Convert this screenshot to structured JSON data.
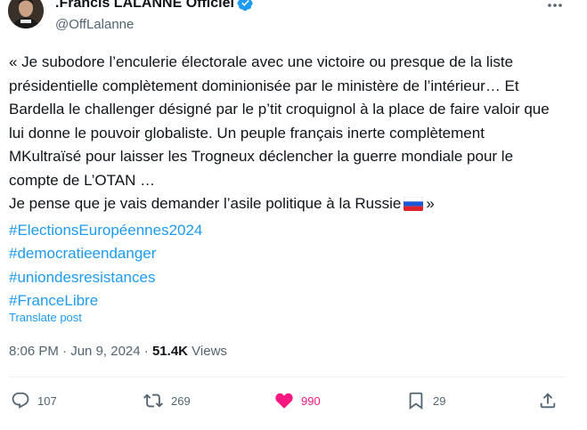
{
  "author": {
    "display_name": ".Francis LALANNE Officiel",
    "handle": "@OffLalanne",
    "verified": true,
    "verified_color": "#1d9bf0"
  },
  "tweet": {
    "paragraphs": [
      "« Je subodore l’enculerie électorale avec une victoire ou presque de la liste présidentielle complètement dominionisée par le ministère de l’intérieur… Et Bardella le challenger désigné par le p’tit croquignol à la place de faire valoir que lui donne le pouvoir globaliste. Un peuple français inerte complètement MKultraïsé pour laisser les Trogneux déclencher la guerre mondiale pour le compte de L’OTAN …",
      "Je pense que je vais demander l’asile politique à la Russie",
      "»"
    ],
    "flag_emoji": "russia-flag-icon",
    "hashtags": [
      "#ElectionsEuropéennes2024",
      "#democratieendanger",
      "#uniondesresistances",
      "#FranceLibre"
    ],
    "translate_label": "Translate post",
    "time": "8:06 PM",
    "separator": "·",
    "date": "Jun 9, 2024",
    "views_count": "51.4K",
    "views_label": "Views"
  },
  "actions": {
    "replies": "107",
    "reposts": "269",
    "likes": "990",
    "bookmarks": "29"
  },
  "colors": {
    "link": "#1d9bf0",
    "muted": "#536471",
    "like": "#f91880",
    "text": "#0f1419"
  }
}
